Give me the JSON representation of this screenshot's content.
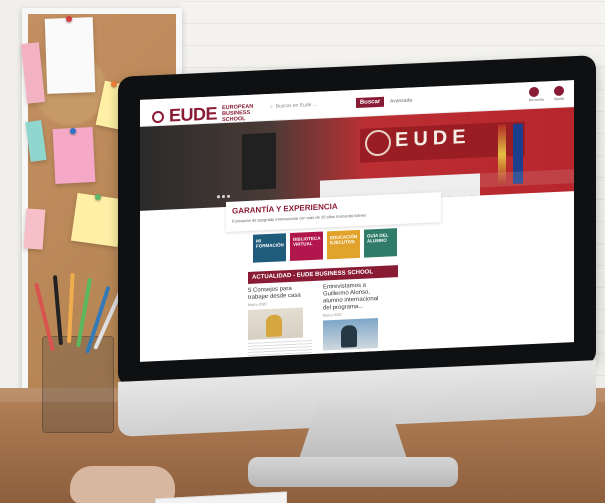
{
  "ui": {
    "logo": {
      "name": "EUDE",
      "subtitle_lines": [
        "EUROPEAN",
        "BUSINESS",
        "SCHOOL"
      ]
    },
    "search": {
      "placeholder": "Buscar en Eude ...",
      "button": "Buscar",
      "advanced": "Avanzada"
    },
    "top_icons": [
      {
        "icon": "user-icon",
        "label": "Mi cuenta"
      },
      {
        "icon": "help-icon",
        "label": "Ayuda"
      }
    ],
    "hero": {
      "banner_text": "EUDE",
      "caption_title": "GARANTÍA Y EXPERIENCIA",
      "caption_sub": "Formación de posgrado internacional con más de 20 años formando líderes"
    },
    "tiles": [
      {
        "label": "MI FORMACIÓN",
        "color": "#1f5b7a"
      },
      {
        "label": "BIBLIOTECA VIRTUAL",
        "color": "#b1164d"
      },
      {
        "label": "EDUCACIÓN EJECUTIVA",
        "color": "#e1a32b"
      },
      {
        "label": "GUÍA DEL ALUMNO",
        "color": "#2f7c69"
      }
    ],
    "news": {
      "header": "ACTUALIDAD - EUDE BUSINESS SCHOOL",
      "cards": [
        {
          "title": "5 Consejos para trabajar desde casa",
          "date": "Marzo 2020"
        },
        {
          "title": "Entrevistamos a Guillermo Alonso, alumno internacional del programa...",
          "date": "Marzo 2020"
        }
      ]
    }
  }
}
